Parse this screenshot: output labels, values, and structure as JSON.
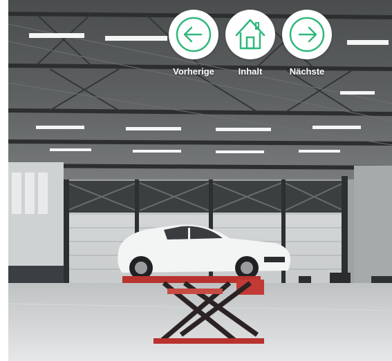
{
  "navigation": {
    "accent_color": "#2fb87a",
    "prev": {
      "label": "Vorherige",
      "icon": "arrow-left-circle-icon"
    },
    "home": {
      "label": "Inhalt",
      "icon": "house-icon"
    },
    "next": {
      "label": "Nächste",
      "icon": "arrow-right-circle-icon"
    }
  },
  "background": {
    "subject": "garage workshop with white car on red scissor lift"
  }
}
